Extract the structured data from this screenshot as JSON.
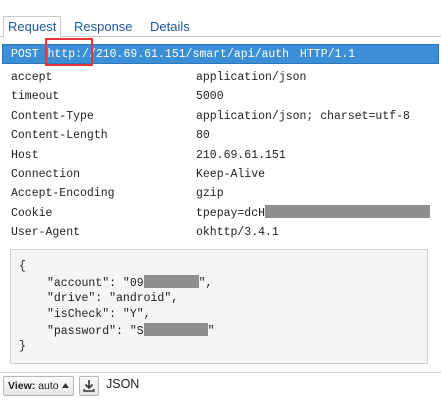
{
  "tabs": [
    {
      "label": "Request",
      "active": true
    },
    {
      "label": "Response",
      "active": false
    },
    {
      "label": "Details",
      "active": false
    }
  ],
  "request_line": {
    "method": "POST",
    "scheme": "http:/",
    "rest": "/210.69.61.151/smart/api/auth",
    "protocol": "HTTP/1.1"
  },
  "headers": [
    {
      "name": "accept",
      "value": "application/json"
    },
    {
      "name": "timeout",
      "value": "5000"
    },
    {
      "name": "Content-Type",
      "value": "application/json; charset=utf-8"
    },
    {
      "name": "Content-Length",
      "value": "80"
    },
    {
      "name": "Host",
      "value": "210.69.61.151"
    },
    {
      "name": "Connection",
      "value": "Keep-Alive"
    },
    {
      "name": "Accept-Encoding",
      "value": "gzip"
    },
    {
      "name": "Cookie",
      "value": "tpepay=dcH"
    },
    {
      "name": "User-Agent",
      "value": "okhttp/3.4.1"
    }
  ],
  "body": {
    "open": "{",
    "close": "}",
    "account_key": "\"account\": ",
    "account_value_start": "\"09",
    "account_value_end": "\",",
    "drive_line": "\"drive\": \"android\",",
    "ischeck_line": "\"isCheck\": \"Y\",",
    "password_key": "\"password\": ",
    "password_value_start": "\"S",
    "password_value_end": "\""
  },
  "bottom_bar": {
    "view_prefix": "View:",
    "view_value": "auto",
    "format": "JSON"
  },
  "colors": {
    "request_line_bg": "#3b8fd6",
    "highlight_box": "#e8343a",
    "tab_text": "#1e5aa0",
    "redaction": "#8f8f8f"
  }
}
